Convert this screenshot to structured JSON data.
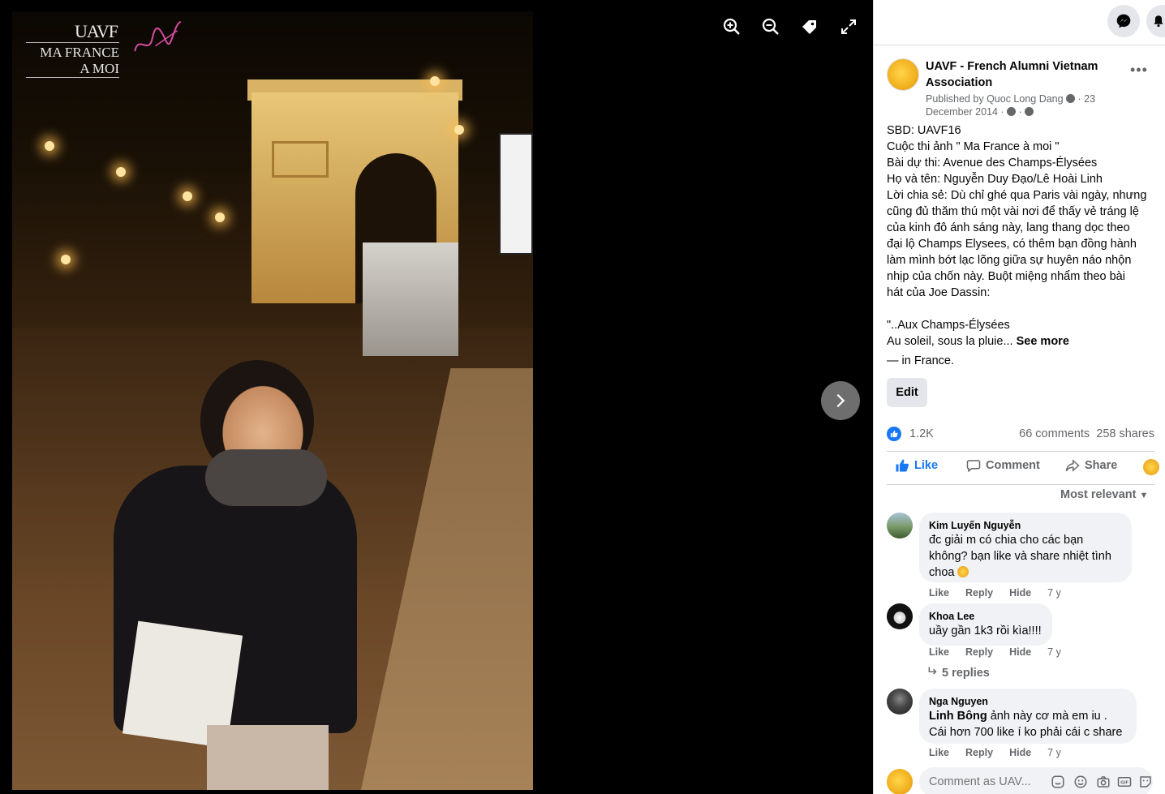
{
  "viewer": {
    "logo_brand": "UAVF",
    "logo_line1": "MA FRANCE",
    "logo_line2": "A MOI",
    "tools": [
      "zoom-in-icon",
      "zoom-out-icon",
      "tag-icon",
      "fullscreen-icon"
    ]
  },
  "post": {
    "page_name": "UAVF - French Alumni Vietnam Association",
    "published_prefix": "Published by",
    "publisher": "Quoc Long Dang",
    "date": "23 December 2014",
    "caption_lines": [
      "SBD: UAVF16",
      "Cuộc thi ảnh \" Ma France à moi \"",
      "Bài dự thi: Avenue des Champs-Élysées",
      "Họ và tên: Nguyễn Duy Đạo/Lê Hoài Linh",
      "Lời chia sẻ: Dù chỉ ghé qua Paris vài ngày, nhưng",
      "cũng đủ thăm thú một vài nơi để thấy vẻ tráng lệ",
      "của kinh đô ánh sáng này, lang thang dọc theo",
      "đại lộ Champs Elysees, có thêm bạn đồng hành",
      "làm mình bớt lạc lõng giữa sự huyên náo nhộn",
      "nhịp của chốn này. Buột miệng nhẩm theo bài",
      "hát của Joe Dassin:",
      "",
      "\"..Aux Champs-Élysées"
    ],
    "caption_last": "Au soleil, sous la pluie...",
    "see_more": "See more",
    "location_prefix": "— in",
    "location": "France.",
    "edit_label": "Edit",
    "like_count": "1.2K",
    "comments_count": "66 comments",
    "shares_count": "258 shares",
    "action_like": "Like",
    "action_comment": "Comment",
    "action_share": "Share",
    "sort_label": "Most relevant"
  },
  "comments": [
    {
      "name": "Kim Luyến Nguyễn",
      "lines": [
        "đc giải m có chia cho các bạn",
        "không? bạn like và share nhiệt tình",
        "choa"
      ],
      "like": "Like",
      "reply": "Reply",
      "hide": "Hide",
      "time": "7 y"
    },
    {
      "name": "Khoa Lee",
      "lines": [
        "uầy gần 1k3 rồi kìa!!!!"
      ],
      "like": "Like",
      "reply": "Reply",
      "hide": "Hide",
      "time": "7 y",
      "replies": "5 replies"
    },
    {
      "name": "Nga Nguyen",
      "mention": "Linh Bông",
      "lines": [
        "ảnh này cơ mà em iu .",
        "Cái hơn 700 like í ko phải cái c share"
      ],
      "like": "Like",
      "reply": "Reply",
      "hide": "Hide",
      "time": "7 y"
    }
  ],
  "composer": {
    "placeholder": "Comment as UAV..."
  },
  "colors": {
    "accent": "#1877f2",
    "panel_bg": "#ffffff",
    "bubble_bg": "#f0f2f5",
    "muted_text": "#65676b"
  }
}
